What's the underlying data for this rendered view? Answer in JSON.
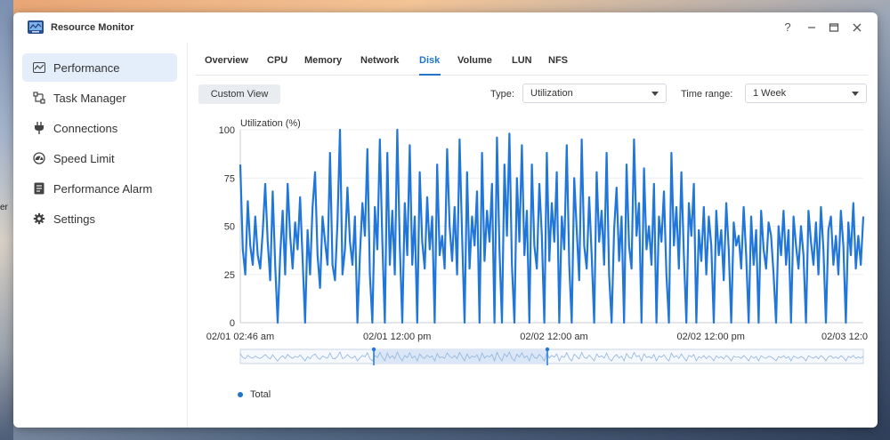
{
  "background": {
    "edge_text": "er"
  },
  "window": {
    "title": "Resource Monitor",
    "controls": {
      "help": "?",
      "minimize": "–",
      "maximize": "▭",
      "close": "✕"
    }
  },
  "sidebar": {
    "items": [
      {
        "label": "Performance",
        "icon": "performance-icon",
        "active": true
      },
      {
        "label": "Task Manager",
        "icon": "task-manager-icon",
        "active": false
      },
      {
        "label": "Connections",
        "icon": "plug-icon",
        "active": false
      },
      {
        "label": "Speed Limit",
        "icon": "gauge-icon",
        "active": false
      },
      {
        "label": "Performance Alarm",
        "icon": "alarm-icon",
        "active": false
      },
      {
        "label": "Settings",
        "icon": "gear-icon",
        "active": false
      }
    ]
  },
  "tabs": [
    {
      "label": "Overview"
    },
    {
      "label": "CPU"
    },
    {
      "label": "Memory"
    },
    {
      "label": "Network"
    },
    {
      "label": "Disk",
      "active": true
    },
    {
      "label": "Volume"
    },
    {
      "label": "LUN"
    },
    {
      "label": "NFS"
    }
  ],
  "toolbar": {
    "custom_view": "Custom View",
    "type_label": "Type:",
    "type_value": "Utilization",
    "range_label": "Time range:",
    "range_value": "1 Week"
  },
  "colors": {
    "accent": "#1f75c9",
    "series": "#2176d9",
    "active_bg": "#e4eefa"
  },
  "chart_data": {
    "type": "line",
    "ylabel": "Utilization (%)",
    "ylim": [
      0,
      100
    ],
    "yticks": [
      0,
      25,
      50,
      75,
      100
    ],
    "xticks": [
      "02/01 02:46 am",
      "02/01 12:00 pm",
      "02/02 12:00 am",
      "02/02 12:00 pm",
      "02/03 12:0"
    ],
    "series": [
      {
        "name": "Total",
        "values": [
          82,
          38,
          25,
          63,
          40,
          30,
          55,
          35,
          28,
          47,
          72,
          42,
          22,
          68,
          30,
          0,
          35,
          58,
          25,
          72,
          45,
          28,
          52,
          38,
          65,
          33,
          0,
          48,
          25,
          60,
          78,
          35,
          18,
          55,
          42,
          30,
          88,
          30,
          22,
          52,
          100,
          25,
          38,
          70,
          42,
          30,
          55,
          0,
          35,
          62,
          45,
          90,
          25,
          0,
          60,
          38,
          95,
          42,
          0,
          88,
          30,
          58,
          25,
          100,
          40,
          0,
          62,
          35,
          92,
          30,
          55,
          0,
          78,
          42,
          28,
          65,
          38,
          55,
          0,
          82,
          35,
          45,
          28,
          90,
          50,
          32,
          60,
          25,
          95,
          45,
          0,
          78,
          28,
          55,
          40,
          68,
          0,
          88,
          32,
          58,
          42,
          72,
          0,
          96,
          38,
          0,
          82,
          45,
          98,
          30,
          0,
          75,
          42,
          92,
          35,
          58,
          0,
          82,
          40,
          28,
          72,
          45,
          0,
          88,
          32,
          62,
          42,
          78,
          0,
          55,
          38,
          92,
          30,
          0,
          75,
          48,
          22,
          95,
          40,
          28,
          65,
          35,
          0,
          78,
          42,
          58,
          30,
          88,
          25,
          0,
          48,
          70,
          32,
          55,
          0,
          82,
          40,
          28,
          95,
          45,
          62,
          0,
          80,
          38,
          50,
          30,
          72,
          0,
          55,
          42,
          68,
          25,
          0,
          88,
          40,
          60,
          28,
          78,
          35,
          0,
          62,
          45,
          72,
          0,
          48,
          32,
          60,
          25,
          55,
          40,
          0,
          58,
          35,
          48,
          22,
          62,
          38,
          0,
          52,
          40,
          45,
          28,
          60,
          35,
          0,
          55,
          30,
          48,
          0,
          58,
          38,
          28,
          52,
          45,
          25,
          0,
          50,
          35,
          58,
          30,
          48,
          0,
          55,
          40,
          28,
          50,
          35,
          0,
          58,
          42,
          30,
          52,
          25,
          60,
          38,
          0,
          48,
          55,
          30,
          45,
          25,
          58,
          40,
          0,
          52,
          35,
          62,
          28,
          45,
          30,
          55
        ]
      }
    ]
  }
}
